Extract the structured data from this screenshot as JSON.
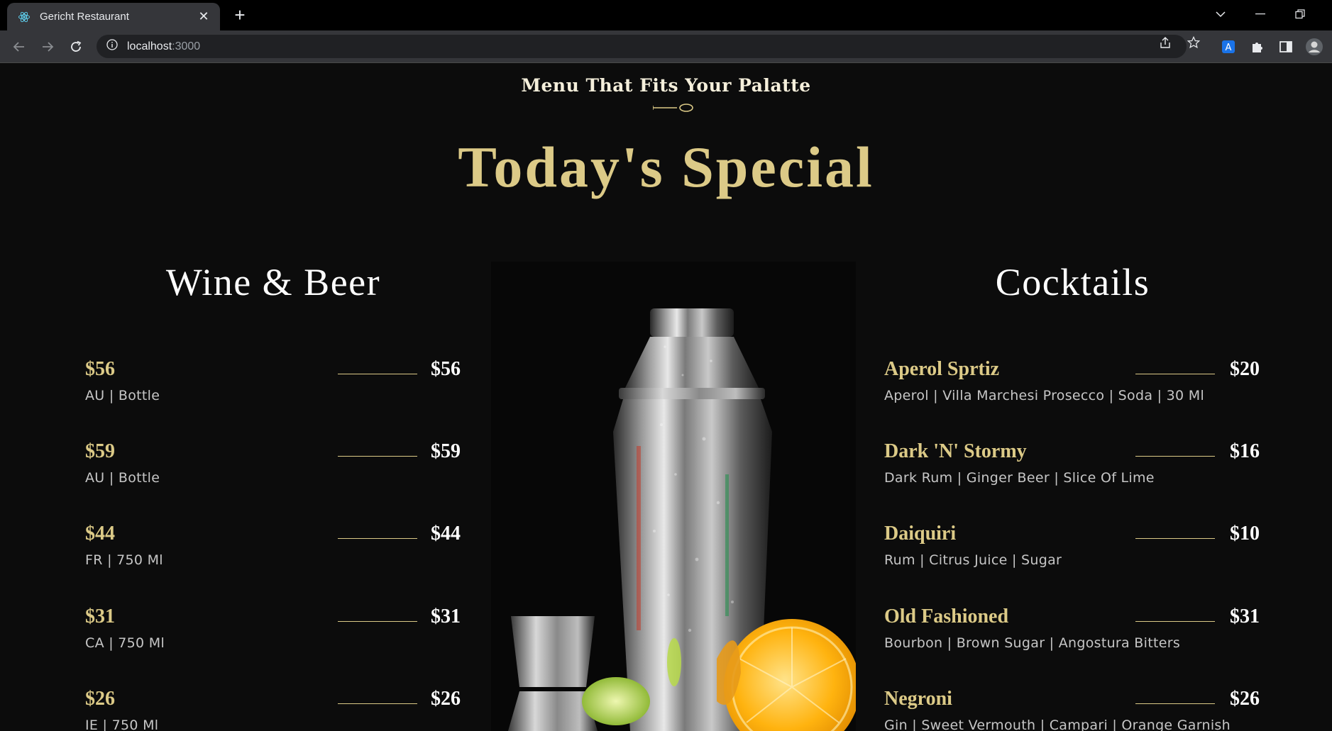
{
  "browser": {
    "tab_title": "Gericht Restaurant",
    "url_host": "localhost",
    "url_port": ":3000"
  },
  "page": {
    "subtitle": "Menu That Fits Your Palatte",
    "title": "Today's Special",
    "wine_heading": "Wine & Beer",
    "cocktails_heading": "Cocktails",
    "wine_items": [
      {
        "name": "$56",
        "price": "$56",
        "tags": "AU | Bottle"
      },
      {
        "name": "$59",
        "price": "$59",
        "tags": "AU | Bottle"
      },
      {
        "name": "$44",
        "price": "$44",
        "tags": "FR | 750 Ml"
      },
      {
        "name": "$31",
        "price": "$31",
        "tags": "CA | 750 Ml"
      },
      {
        "name": "$26",
        "price": "$26",
        "tags": "IE | 750 Ml"
      }
    ],
    "cocktail_items": [
      {
        "name": "Aperol Sprtiz",
        "price": "$20",
        "tags": "Aperol | Villa Marchesi Prosecco | Soda | 30 Ml"
      },
      {
        "name": "Dark 'N' Stormy",
        "price": "$16",
        "tags": "Dark Rum | Ginger Beer | Slice Of Lime"
      },
      {
        "name": "Daiquiri",
        "price": "$10",
        "tags": "Rum | Citrus Juice | Sugar"
      },
      {
        "name": "Old Fashioned",
        "price": "$31",
        "tags": "Bourbon | Brown Sugar | Angostura Bitters"
      },
      {
        "name": "Negroni",
        "price": "$26",
        "tags": "Gin | Sweet Vermouth | Campari | Orange Garnish"
      }
    ]
  },
  "colors": {
    "gold": "#dcca87",
    "background": "#0c0c0c",
    "white": "#ffffff",
    "tags_gray": "#c6c6c6"
  }
}
